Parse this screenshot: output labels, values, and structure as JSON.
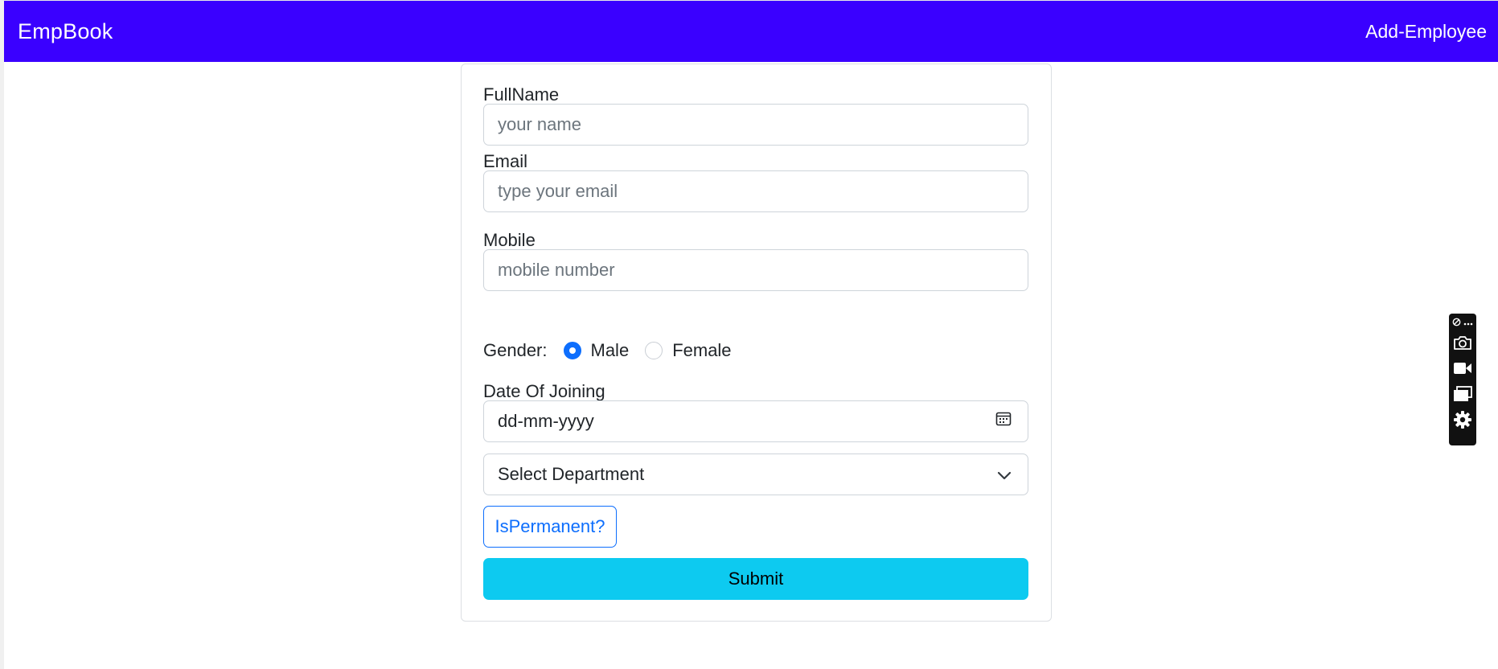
{
  "navbar": {
    "brand": "EmpBook",
    "link": "Add-Employee",
    "bg_color": "#3a00ff"
  },
  "form": {
    "fullname": {
      "label": "FullName",
      "placeholder": "your name"
    },
    "email": {
      "label": "Email",
      "placeholder": "type your email"
    },
    "mobile": {
      "label": "Mobile",
      "placeholder": "mobile number"
    },
    "gender": {
      "label": "Gender:",
      "options": [
        {
          "label": "Male",
          "checked": true
        },
        {
          "label": "Female",
          "checked": false
        }
      ]
    },
    "doj": {
      "label": "Date Of Joining",
      "placeholder": "dd-mm-yyyy",
      "icon": "calendar-icon"
    },
    "department": {
      "selected": "Select Department",
      "icon": "chevron-down-icon"
    },
    "permanent_button": "IsPermanent?",
    "submit_button": "Submit"
  },
  "side_toolbar": {
    "icons": [
      "extension-icon",
      "more-icon",
      "camera-icon",
      "video-icon",
      "windows-icon",
      "gear-icon"
    ]
  },
  "colors": {
    "primary": "#0d6efd",
    "submit": "#0dcaf0"
  }
}
